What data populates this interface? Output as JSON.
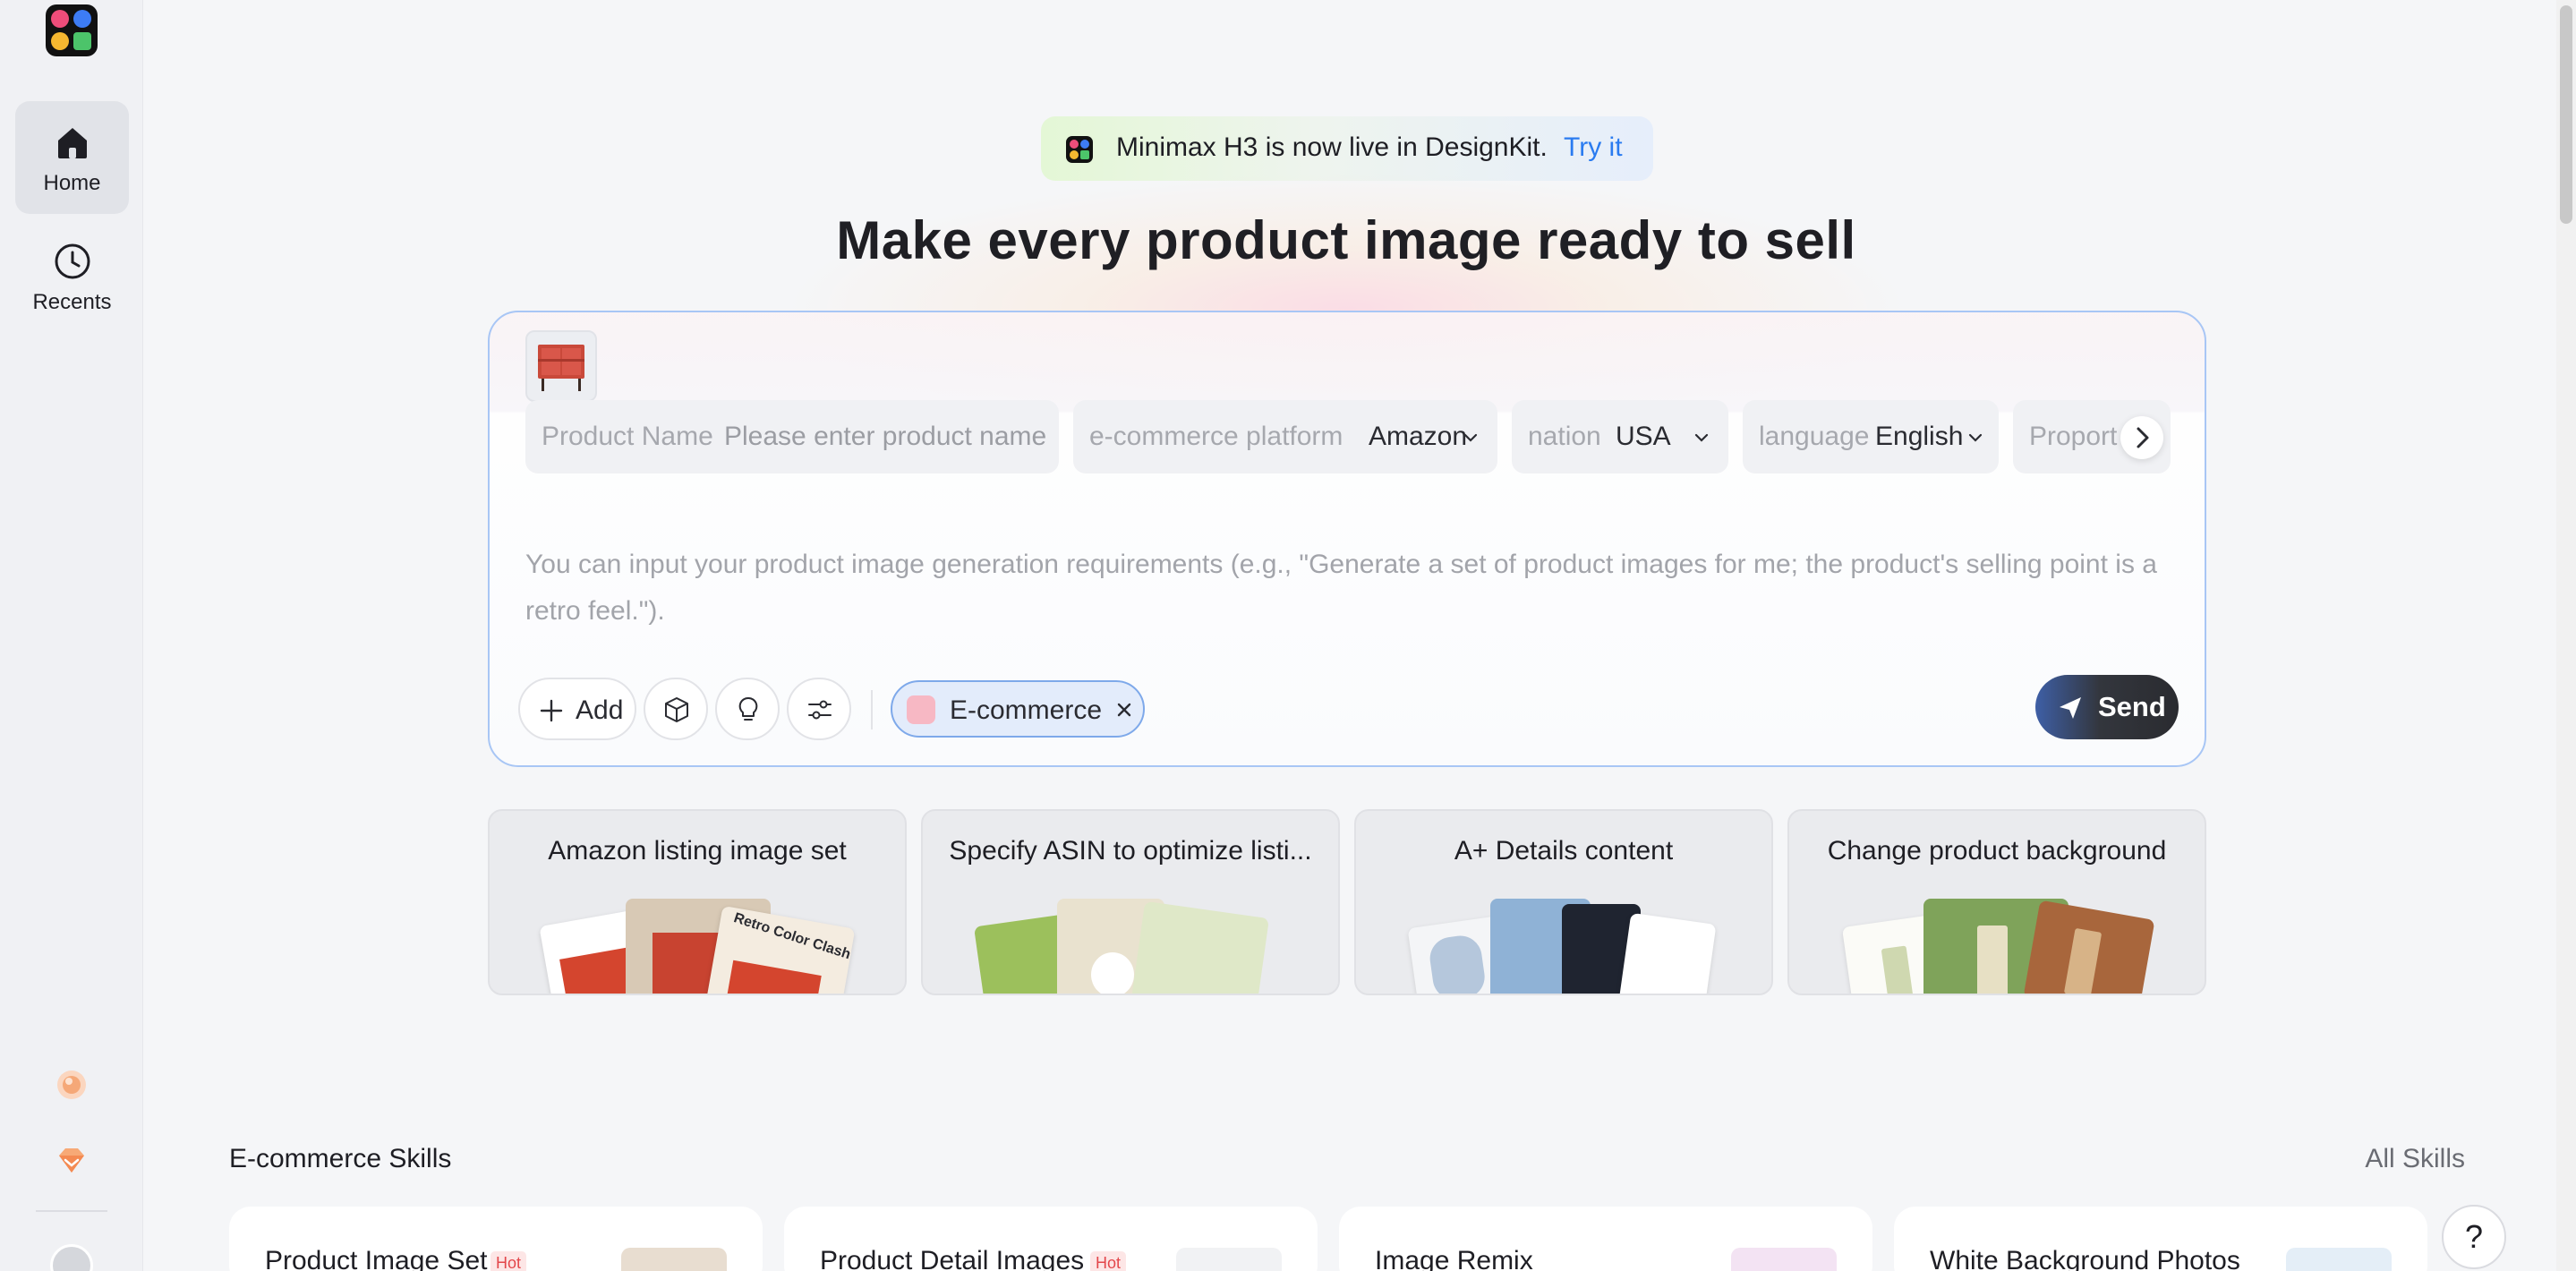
{
  "sidebar": {
    "items": [
      {
        "label": "Home",
        "icon": "home-icon",
        "active": true
      },
      {
        "label": "Recents",
        "icon": "clock-icon",
        "active": false
      }
    ]
  },
  "banner": {
    "text": "Minimax H3 is now live in DesignKit.",
    "link": "Try it"
  },
  "headline": "Make every product image ready to sell",
  "composer": {
    "fields": [
      {
        "label": "Product Name",
        "value": "Please enter product name",
        "is_placeholder": true
      },
      {
        "label": "e-commerce platform",
        "value": "Amazon"
      },
      {
        "label": "nation",
        "value": "USA"
      },
      {
        "label": "language",
        "value": "English"
      },
      {
        "label": "Proport",
        "value": ""
      }
    ],
    "prompt_placeholder": "You can input your product image generation requirements (e.g., \"Generate a set of product images for me; the product's selling point is a retro feel.\").",
    "add_label": "Add",
    "chip_label": "E-commerce",
    "send_label": "Send"
  },
  "quick_cards": [
    {
      "title": "Amazon listing image set",
      "image_text": "Retro Color Clash"
    },
    {
      "title": "Specify ASIN to optimize listi..."
    },
    {
      "title": "A+ Details content"
    },
    {
      "title": "Change product background"
    }
  ],
  "skills_section": {
    "title": "E-commerce Skills",
    "all_link": "All Skills",
    "items": [
      {
        "name": "Product Image Set",
        "badge": "Hot"
      },
      {
        "name": "Product Detail Images",
        "badge": "Hot"
      },
      {
        "name": "Image Remix",
        "badge": ""
      },
      {
        "name": "White Background Photos",
        "badge": ""
      }
    ]
  },
  "help_label": "?",
  "colors": {
    "accent_blue": "#2a7bf0",
    "card_border": "#a8c6f5",
    "hot_badge": "#e3474b"
  }
}
